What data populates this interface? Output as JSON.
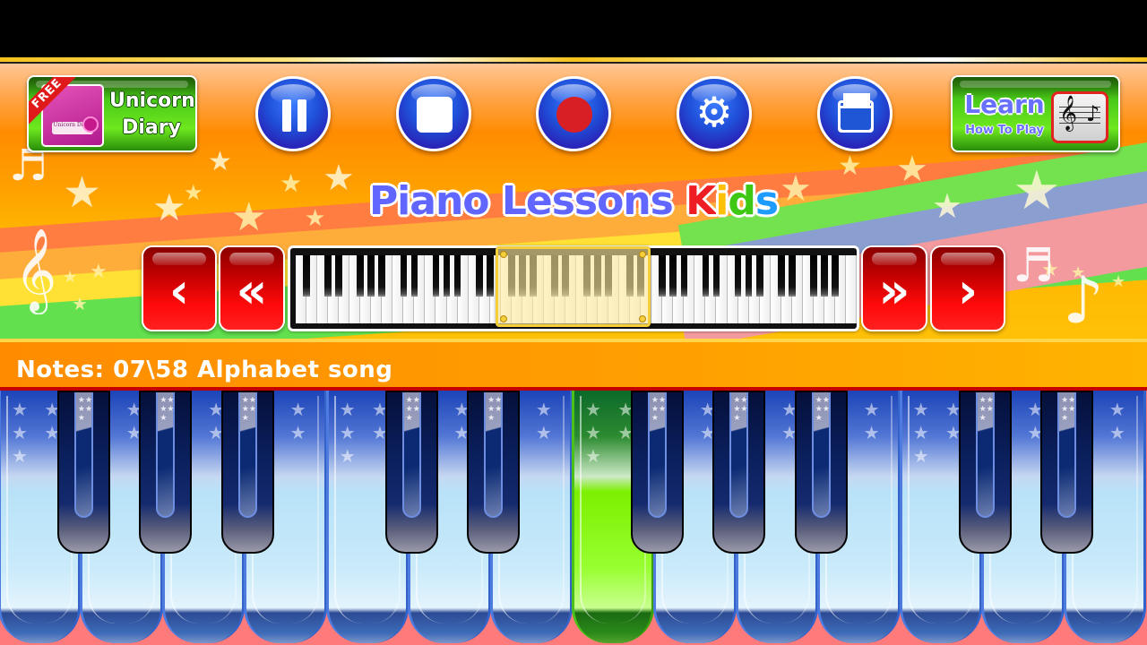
{
  "app": {
    "title_main": "Piano Lessons ",
    "title_accent_letters": [
      {
        "char": "K",
        "color": "#ee1d24"
      },
      {
        "char": "i",
        "color": "#ffc107"
      },
      {
        "char": "d",
        "color": "#3ec813"
      },
      {
        "char": "s",
        "color": "#1e9bff"
      }
    ]
  },
  "promos": {
    "unicorn_diary": {
      "ribbon": "FREE",
      "thumb_label": "Unicorn Diary",
      "line1": "Unicorn",
      "line2": "Diary"
    },
    "learn": {
      "line1": "Learn",
      "line2": "How To Play",
      "clef_glyph": "𝄞",
      "note_glyph": "♪"
    }
  },
  "toolbar": {
    "buttons": [
      {
        "name": "pause",
        "icon": "pause-icon"
      },
      {
        "name": "stop",
        "icon": "stop-icon"
      },
      {
        "name": "record",
        "icon": "record-icon"
      },
      {
        "name": "settings",
        "icon": "gear-icon",
        "glyph": "⚙"
      },
      {
        "name": "open",
        "icon": "folder-icon"
      }
    ]
  },
  "navigation": {
    "prev_glyph": "‹",
    "rewind_glyph": "«",
    "fastforward_glyph": "»",
    "next_glyph": "›"
  },
  "mini_keyboard": {
    "white_key_count": 52,
    "visible_range_start_fraction": 0.36,
    "visible_range_end_fraction": 0.64
  },
  "status": {
    "text": "Notes: 07\\58  Alphabet song",
    "notes_played": "07",
    "notes_total": "58",
    "song": "Alphabet song",
    "accent": "#ffa000"
  },
  "keyboard": {
    "white_keys": 14,
    "active_white_key_index": 7,
    "active_color": "#7cf000",
    "black_key_after_white": [
      0,
      1,
      2,
      4,
      5,
      7,
      8,
      9,
      11,
      12
    ]
  },
  "decor": {
    "star_glyph": "★",
    "treble_glyph": "𝄞",
    "beamed_notes_glyph": "♬",
    "eighth_note_glyph": "♪"
  }
}
